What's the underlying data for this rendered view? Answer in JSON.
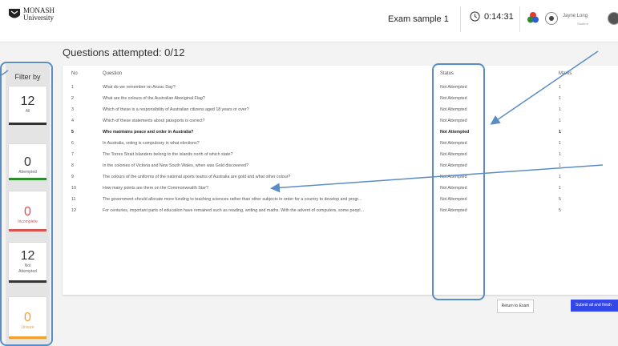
{
  "header": {
    "logo_line1": "MONASH",
    "logo_line2": "University",
    "exam_title": "Exam sample 1",
    "timer": "0:14:31",
    "user_name": "Jayne Long",
    "user_role": "Student"
  },
  "page_title": "Questions attempted: 0/12",
  "filter": {
    "title": "Filter by",
    "cards": [
      {
        "count": "12",
        "label": "All",
        "color": "#333333"
      },
      {
        "count": "0",
        "label": "Attempted",
        "color": "#2e8b2e"
      },
      {
        "count": "0",
        "label": "Incomplete",
        "color": "#d9534f"
      },
      {
        "count": "12",
        "label": "Not Attempted",
        "color": "#333333"
      },
      {
        "count": "0",
        "label": "Unsure",
        "color": "#f0a030"
      }
    ]
  },
  "table": {
    "headers": {
      "no": "No",
      "question": "Question",
      "status": "Status",
      "marks": "Marks"
    },
    "rows": [
      {
        "no": "1",
        "question": "What do we remember on Anzac Day?",
        "status": "Not Attempted",
        "marks": "1"
      },
      {
        "no": "2",
        "question": "What are the colours of the Australian Aboriginal Flag?",
        "status": "Not Attempted",
        "marks": "1"
      },
      {
        "no": "3",
        "question": "Which of these is a responsibility of Australian citizens aged 18 years or over?",
        "status": "Not Attempted",
        "marks": "1"
      },
      {
        "no": "4",
        "question": "Which of these statements about passports is correct?",
        "status": "Not Attempted",
        "marks": "1"
      },
      {
        "no": "5",
        "question": "Who maintains peace and order in Australia?",
        "status": "Not Attempted",
        "marks": "1"
      },
      {
        "no": "6",
        "question": "In Australia, voting is compulsory in what elections?",
        "status": "Not Attempted",
        "marks": "1"
      },
      {
        "no": "7",
        "question": "The Torres Strait Islanders belong to the islands north of which state?",
        "status": "Not Attempted",
        "marks": "1"
      },
      {
        "no": "8",
        "question": "In the colonies of Victoria and New South Wales, when was Gold discovered?",
        "status": "Not Attempted",
        "marks": "1"
      },
      {
        "no": "9",
        "question": "The colours of the uniforms of the national sports teams of Australia are gold and what other colour?",
        "status": "Not Attempted",
        "marks": "1"
      },
      {
        "no": "10",
        "question": "How many points are there on the Commonwealth Star?",
        "status": "Not Attempted",
        "marks": "1"
      },
      {
        "no": "11",
        "question": "The government should allocate more funding to teaching sciences rather than other subjects in order for a country to develop and progr...",
        "status": "Not Attempted",
        "marks": "5"
      },
      {
        "no": "12",
        "question": "For centuries, important parts of education have remained such as reading, writing and maths. With the advent of computers, some peopl...",
        "status": "Not Attempted",
        "marks": "5"
      }
    ]
  },
  "actions": {
    "return_label": "Return to Exam",
    "submit_label": "Submit all and finish"
  },
  "colors": {
    "accent": "#3346e8",
    "highlight": "#5b8dc4"
  }
}
